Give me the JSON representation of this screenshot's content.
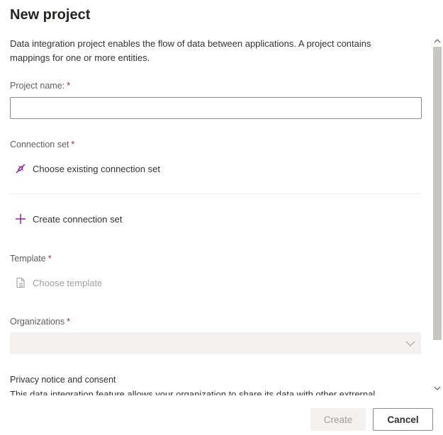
{
  "panel": {
    "title": "New project",
    "description": "Data integration project enables the flow of data between applications. A project contains mappings for one or more entities."
  },
  "project_name": {
    "label": "Project name:",
    "required_mark": "*",
    "value": "",
    "placeholder": ""
  },
  "connection_set": {
    "label": "Connection set",
    "required_mark": "*",
    "choose_existing_label": "Choose existing connection set",
    "choose_existing_icon": "connection-plug-icon",
    "create_label": "Create connection set",
    "create_icon": "plus-icon"
  },
  "template": {
    "label": "Template",
    "required_mark": "*",
    "choose_label": "Choose template",
    "choose_icon": "document-icon"
  },
  "organizations": {
    "label": "Organizations",
    "required_mark": "*",
    "selected_value": "",
    "chevron_icon": "chevron-down-icon"
  },
  "privacy": {
    "label": "Privacy notice and consent",
    "text_partial": "This data integration feature allows your organization to share its data with other extrernal systems"
  },
  "footer": {
    "create_label": "Create",
    "cancel_label": "Cancel"
  },
  "colors": {
    "accent_purple": "#881798",
    "required_red": "#a4262c",
    "disabled_bg": "#f3f2f1",
    "disabled_text": "#a19f9d"
  }
}
